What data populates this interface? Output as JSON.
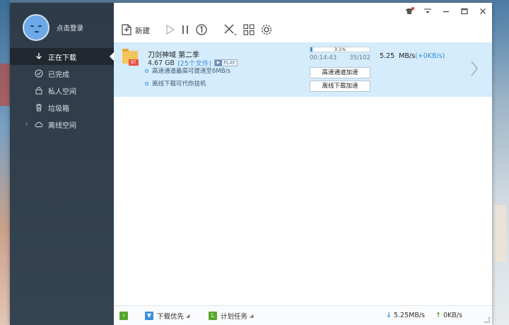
{
  "sidebar": {
    "login_label": "点击登录",
    "items": [
      {
        "label": "正在下载",
        "icon": "download-arrow-icon",
        "active": true
      },
      {
        "label": "已完成",
        "icon": "check-circle-icon",
        "active": false
      },
      {
        "label": "私人空间",
        "icon": "lock-icon",
        "active": false
      },
      {
        "label": "垃圾箱",
        "icon": "trash-icon",
        "active": false
      },
      {
        "label": "离线空间",
        "icon": "cloud-icon",
        "active": false
      }
    ]
  },
  "titlebar": {
    "icons": [
      "skin-icon",
      "menu-icon",
      "minimize-icon",
      "maximize-icon",
      "close-icon"
    ]
  },
  "toolbar": {
    "new_label": "新建",
    "icons": [
      "new-task-icon",
      "start-icon",
      "pause-icon",
      "limit-speed-icon",
      "delete-icon",
      "grid-icon",
      "settings-icon"
    ]
  },
  "task": {
    "name": "刀剑神域 第二季",
    "size": "4.67 GB",
    "file_count": "(25个文件)",
    "play_label": "PLAY",
    "badge": "BT",
    "tips": [
      "高速通道最高可提速至6MB/s",
      "离线下载可代你挂机"
    ],
    "progress_percent": 3.1,
    "progress_text": "3.1%",
    "elapsed": "00:14:43",
    "pieces": "35/102",
    "speed": "5.25",
    "speed_unit": "MB/s",
    "speed_boost": "(+0KB/s)",
    "buttons": [
      "高速通道加速",
      "离线下载加速"
    ]
  },
  "statusbar": {
    "priority_label": "下载优先",
    "schedule_label": "计划任务",
    "down_speed": "5.25MB/s",
    "up_speed": "0KB/s"
  },
  "colors": {
    "sidebar_bg": "#2e3b48",
    "active_item_bg": "#21282f",
    "task_row_bg": "#d4ecfb",
    "accent_blue": "#3a8fd9",
    "accent_green": "#58a62e"
  }
}
